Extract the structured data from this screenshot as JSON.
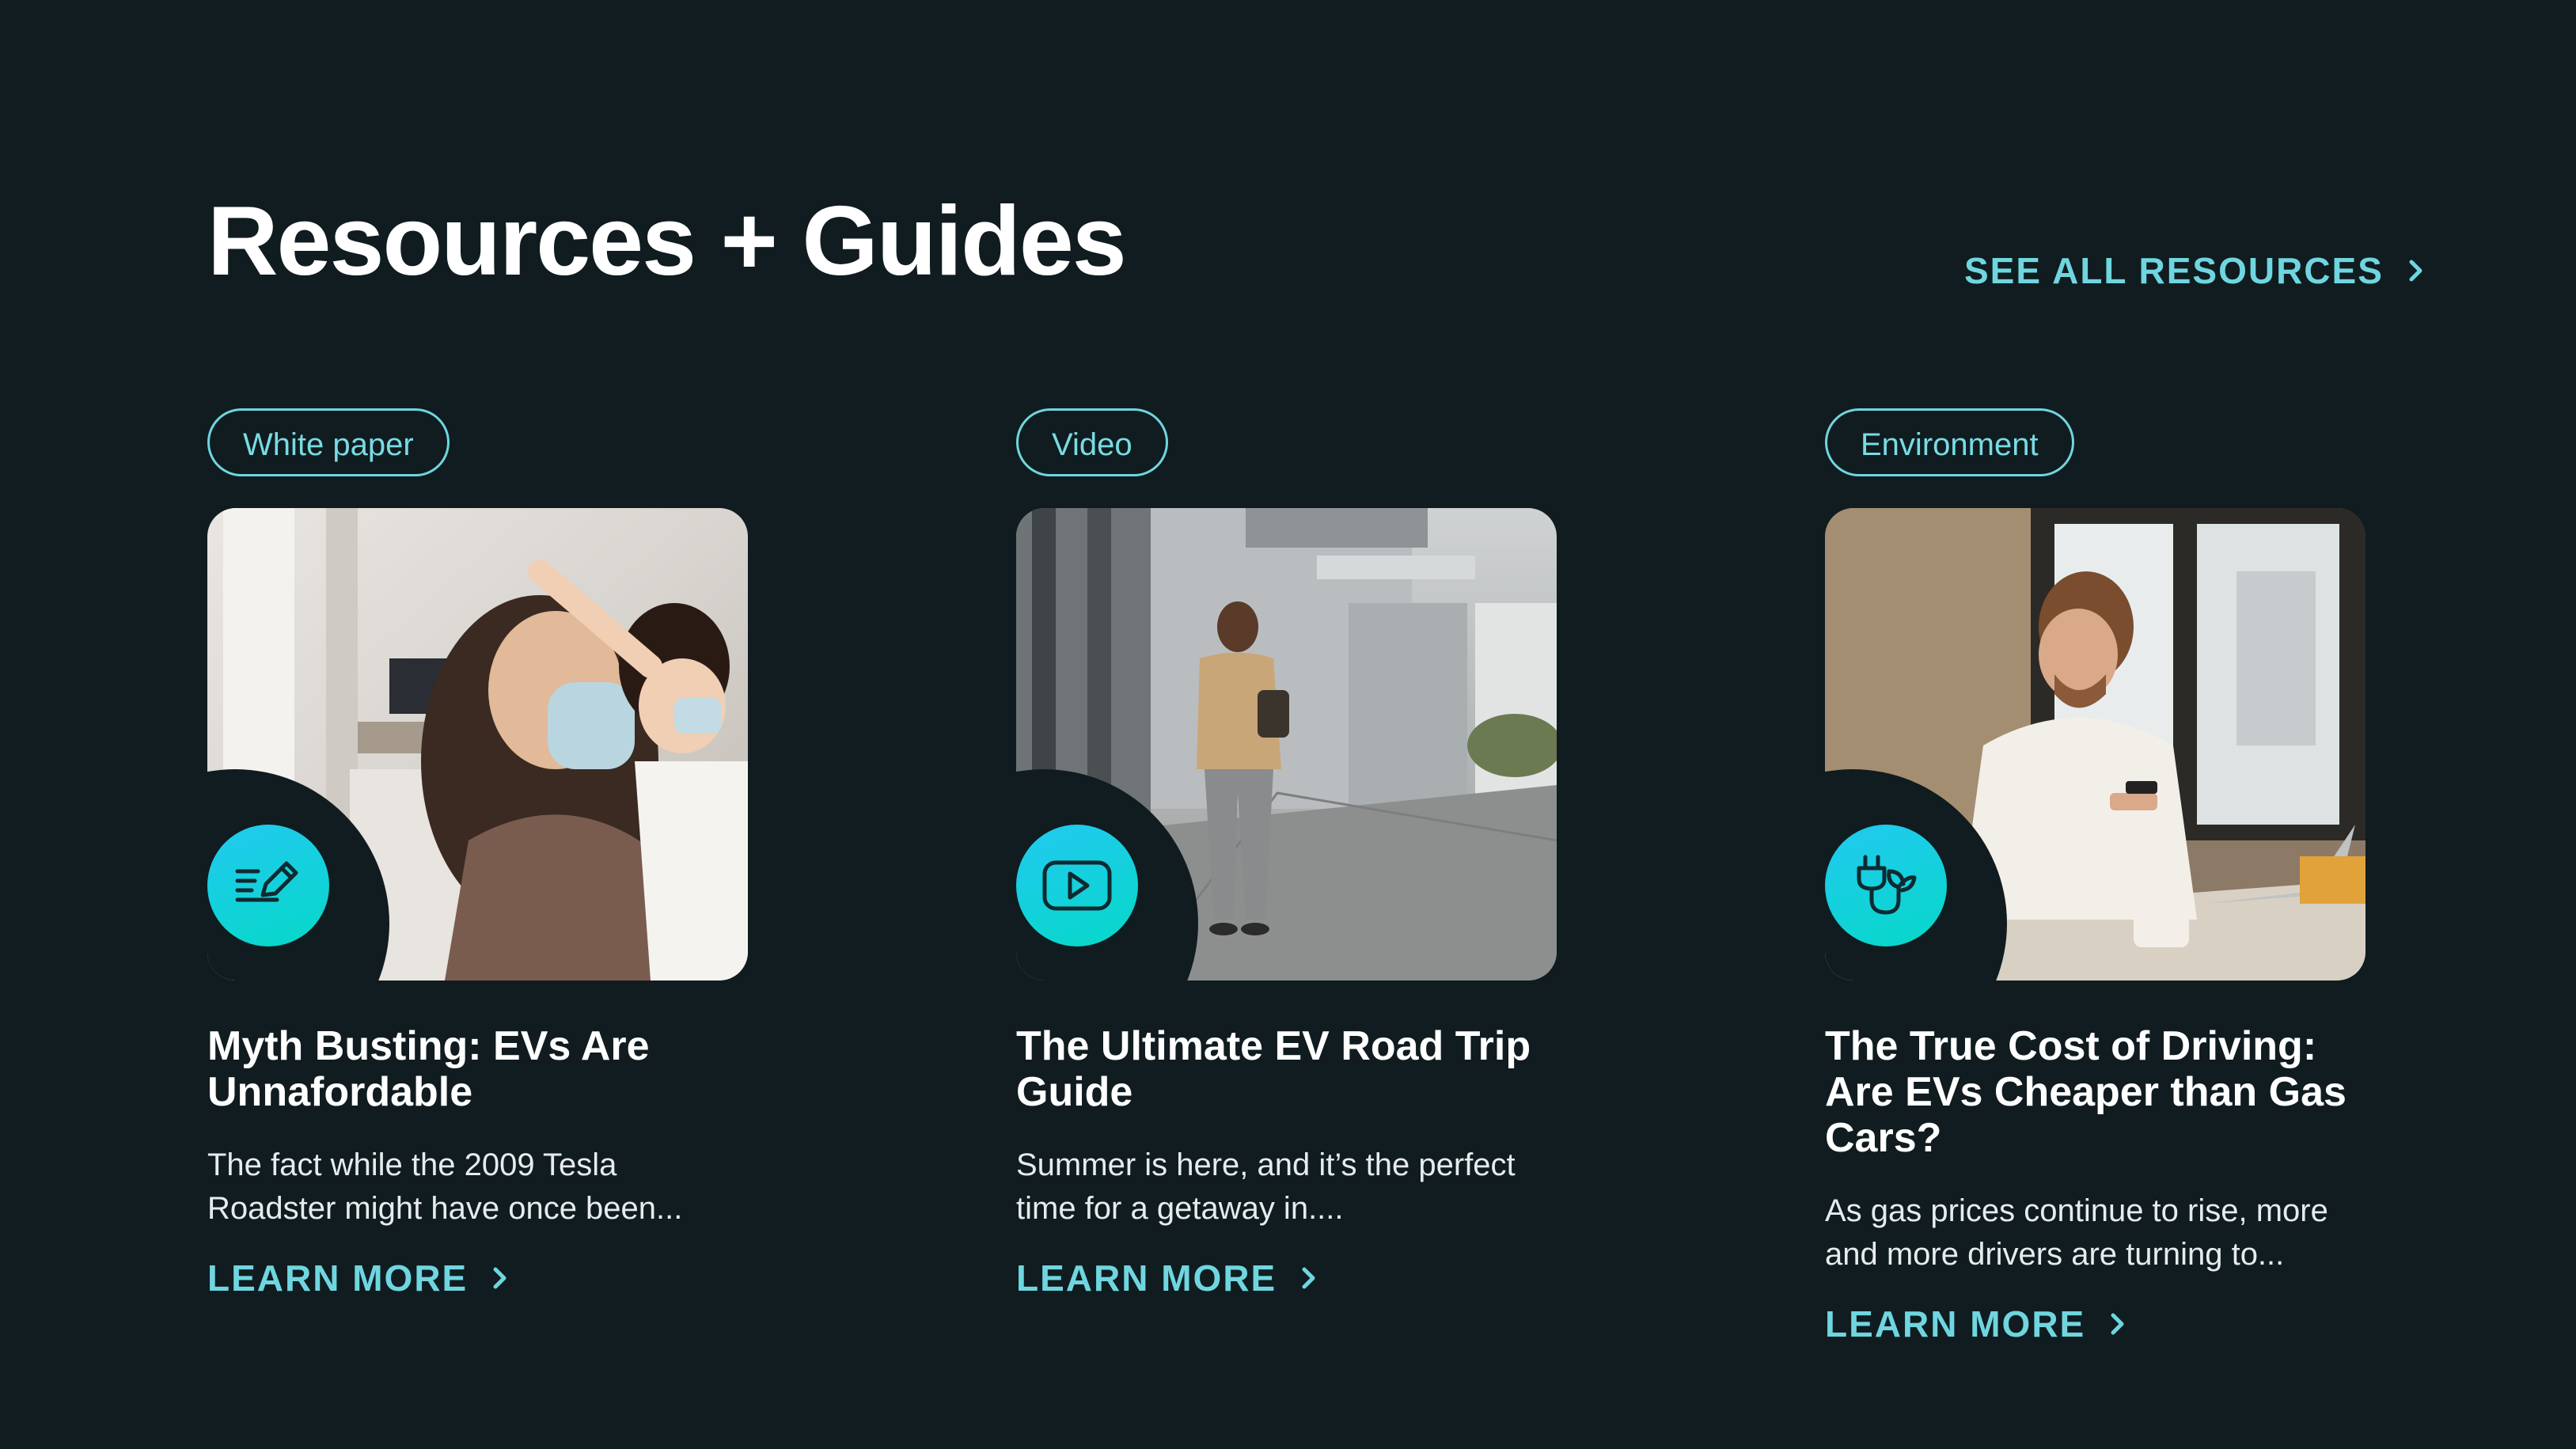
{
  "section": {
    "title": "Resources + Guides",
    "see_all_label": "SEE ALL RESOURCES"
  },
  "cards": [
    {
      "tag": "White paper",
      "icon": "pen-document-icon",
      "title": "Myth Busting: EVs Are Unnafordable",
      "description": "The fact while the 2009 Tesla Roadster might have once been...",
      "cta": "LEARN MORE"
    },
    {
      "tag": "Video",
      "icon": "play-video-icon",
      "title": "The Ultimate EV Road Trip Guide",
      "description": "Summer is here, and it’s the perfect time for a getaway in....",
      "cta": "LEARN MORE"
    },
    {
      "tag": "Environment",
      "icon": "eco-plug-icon",
      "title": "The True Cost of Driving: Are EVs Cheaper than Gas Cars?",
      "description": "As gas prices continue to rise, more and more drivers are turning to...",
      "cta": "LEARN MORE"
    }
  ],
  "colors": {
    "background": "#101c1f",
    "accent": "#6fd6e0",
    "badge_gradient_start": "#22c9f0",
    "badge_gradient_end": "#06d8c8"
  }
}
